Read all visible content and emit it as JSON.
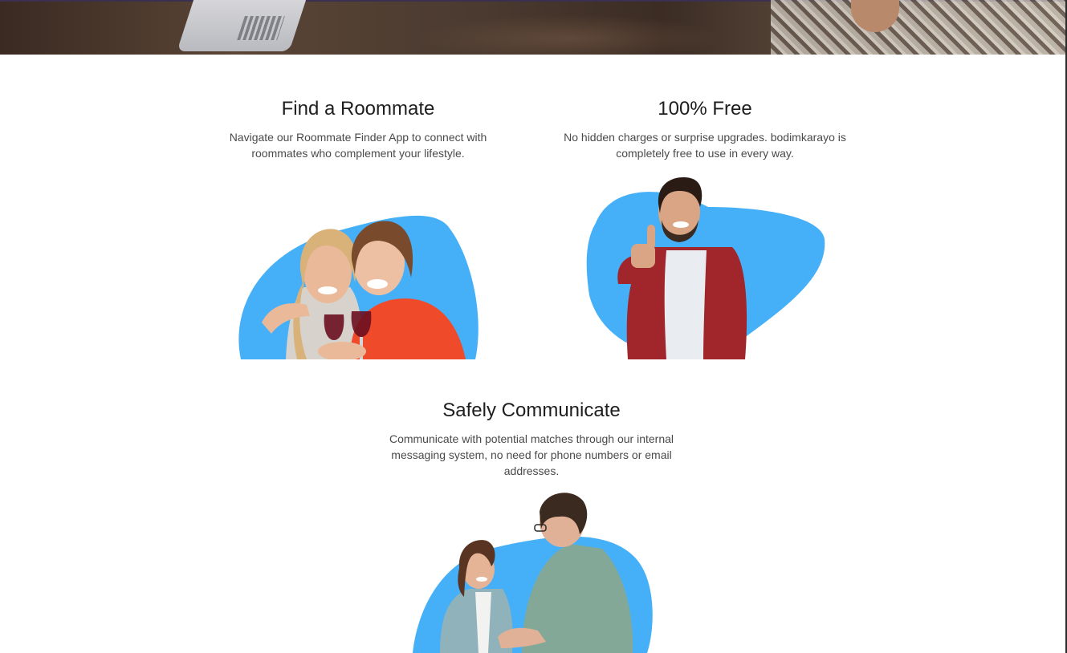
{
  "colors": {
    "blob": "#45B0F8",
    "heading": "#1e1e1e",
    "body_text": "#4a4a4a",
    "background": "#ffffff"
  },
  "hero": {
    "image": "office-desk-laptop-photo"
  },
  "features": [
    {
      "title": "Find a Roommate",
      "description": "Navigate our Roommate Finder App to connect with roommates who complement your lifestyle.",
      "image": "two-women-toasting-wine-photo"
    },
    {
      "title": "100% Free",
      "description": "No hidden charges or surprise upgrades. bodimkarayo is completely free to use in every way.",
      "image": "man-thumbs-up-photo"
    },
    {
      "title": "Safely Communicate",
      "description": "Communicate with potential matches through our internal messaging system, no need for phone numbers or email addresses.",
      "image": "two-people-handshake-photo"
    }
  ]
}
